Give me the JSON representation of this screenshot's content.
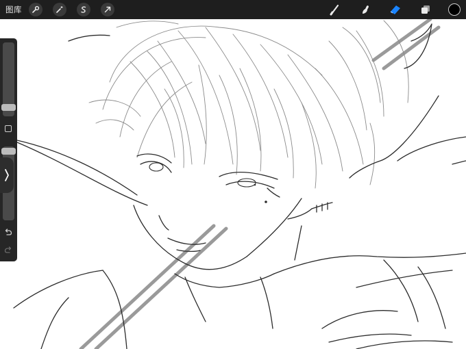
{
  "app": "Procreate",
  "topbar": {
    "gallery_label": "图库",
    "tools_left": [
      {
        "icon": "wrench-icon",
        "name": "actions"
      },
      {
        "icon": "magic-wand-icon",
        "name": "adjustments"
      },
      {
        "icon": "selection-s-icon",
        "name": "selection"
      },
      {
        "icon": "arrow-cursor-icon",
        "name": "transform"
      }
    ],
    "tools_right": [
      {
        "icon": "brush-icon",
        "name": "brush"
      },
      {
        "icon": "smudge-icon",
        "name": "smudge"
      },
      {
        "icon": "eraser-icon",
        "name": "eraser",
        "active": true
      },
      {
        "icon": "layers-icon",
        "name": "layers"
      }
    ],
    "current_color": "#000000"
  },
  "sidebar": {
    "size_level": 0.78,
    "opacity_level": 0.05,
    "icons": [
      "square-icon",
      "undo-icon",
      "redo-icon"
    ],
    "expand_icon": "chevron-right-icon"
  },
  "colors": {
    "toolbar_bg": "#1e1e1e",
    "accent_eraser": "#1a84ff",
    "stroke": "#2b2b2b",
    "stroke_light": "#7a7a7a",
    "diagonal": "#9a9a9a"
  }
}
